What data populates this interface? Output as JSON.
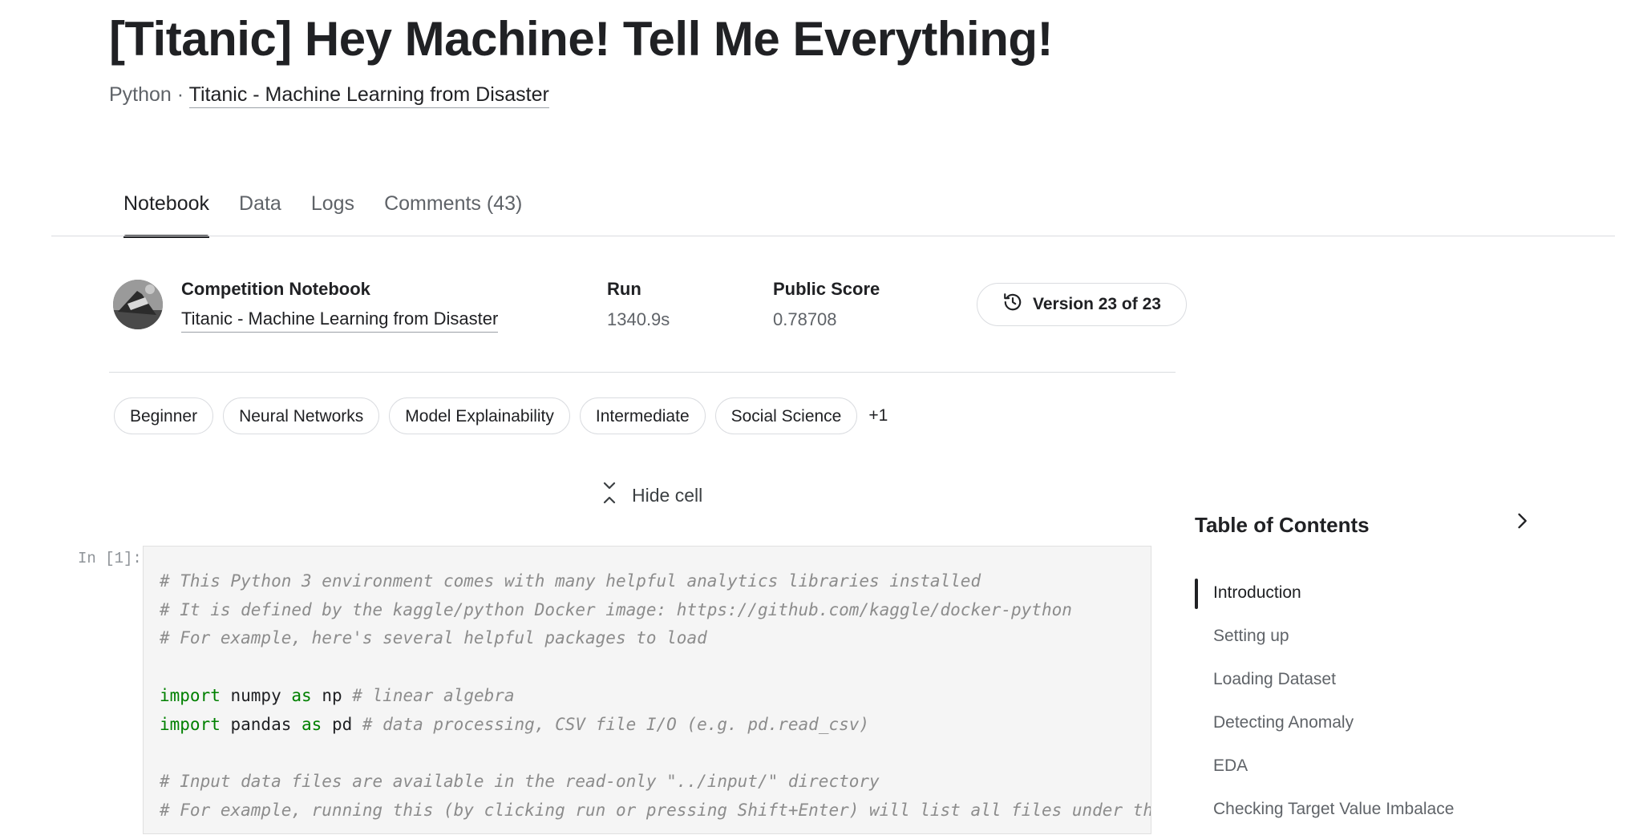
{
  "header": {
    "title": "[Titanic] Hey Machine! Tell Me Everything!",
    "language": "Python",
    "separator": " · ",
    "competition_link": "Titanic - Machine Learning from Disaster"
  },
  "tabs": [
    {
      "label": "Notebook",
      "active": true
    },
    {
      "label": "Data",
      "active": false
    },
    {
      "label": "Logs",
      "active": false
    },
    {
      "label": "Comments (43)",
      "active": false
    }
  ],
  "meta": {
    "competition_label": "Competition Notebook",
    "competition_name": "Titanic - Machine Learning from Disaster",
    "run_label": "Run",
    "run_value": "1340.9s",
    "score_label": "Public Score",
    "score_value": "0.78708",
    "version_button": "Version 23 of 23"
  },
  "tags": [
    "Beginner",
    "Neural Networks",
    "Model Explainability",
    "Intermediate",
    "Social Science"
  ],
  "tags_more": "+1",
  "hide_cell_label": "Hide cell",
  "cell": {
    "prompt": "In [1]:",
    "lines": [
      "# This Python 3 environment comes with many helpful analytics libraries installed",
      "# It is defined by the kaggle/python Docker image: https://github.com/kaggle/docker-python",
      "# For example, here's several helpful packages to load",
      "",
      "import numpy as np # linear algebra",
      "import pandas as pd # data processing, CSV file I/O (e.g. pd.read_csv)",
      "",
      "# Input data files are available in the read-only \"../input/\" directory",
      "# For example, running this (by clicking run or pressing Shift+Enter) will list all files under the input directory"
    ]
  },
  "toc": {
    "title": "Table of Contents",
    "items": [
      {
        "label": "Introduction",
        "active": true
      },
      {
        "label": "Setting up",
        "active": false
      },
      {
        "label": "Loading Dataset",
        "active": false
      },
      {
        "label": "Detecting Anomaly",
        "active": false
      },
      {
        "label": "EDA",
        "active": false
      },
      {
        "label": "Checking Target Value Imbalace",
        "active": false
      }
    ]
  }
}
